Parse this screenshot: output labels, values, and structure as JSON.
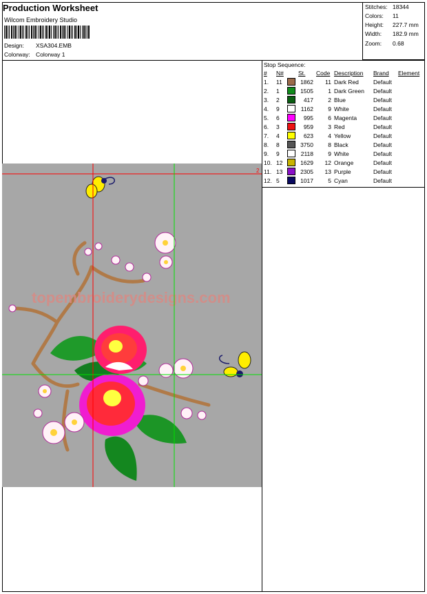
{
  "header": {
    "title": "Production Worksheet",
    "software": "Wilcom Embroidery Studio",
    "design_label": "Design:",
    "design_value": "XSA304.EMB",
    "colorway_label": "Colorway:",
    "colorway_value": "Colorway 1"
  },
  "stats": [
    {
      "label": "Stitches:",
      "value": "18344"
    },
    {
      "label": "Colors:",
      "value": "11"
    },
    {
      "label": "Height:",
      "value": "227.7 mm"
    },
    {
      "label": "Width:",
      "value": "182.9 mm"
    },
    {
      "label": "Zoom:",
      "value": "0.68"
    }
  ],
  "stop_sequence": {
    "title": "Stop Sequence:",
    "columns": [
      "#",
      "N#",
      "St.",
      "Code",
      "Description",
      "Brand",
      "Element"
    ],
    "rows": [
      {
        "idx": "1.",
        "n": "11",
        "st": "1862",
        "code": "11",
        "desc": "Dark Red",
        "brand": "Default",
        "color": "#9b6b4b"
      },
      {
        "idx": "2.",
        "n": "1",
        "st": "1505",
        "code": "1",
        "desc": "Dark Green",
        "brand": "Default",
        "color": "#108c1c"
      },
      {
        "idx": "3.",
        "n": "2",
        "st": "417",
        "code": "2",
        "desc": "Blue",
        "brand": "Default",
        "color": "#0b5e12"
      },
      {
        "idx": "4.",
        "n": "9",
        "st": "1162",
        "code": "9",
        "desc": "White",
        "brand": "Default",
        "color": "#ffffff"
      },
      {
        "idx": "5.",
        "n": "6",
        "st": "995",
        "code": "6",
        "desc": "Magenta",
        "brand": "Default",
        "color": "#ff00ff"
      },
      {
        "idx": "6.",
        "n": "3",
        "st": "959",
        "code": "3",
        "desc": "Red",
        "brand": "Default",
        "color": "#ee1111"
      },
      {
        "idx": "7.",
        "n": "4",
        "st": "623",
        "code": "4",
        "desc": "Yellow",
        "brand": "Default",
        "color": "#ffff00"
      },
      {
        "idx": "8.",
        "n": "8",
        "st": "3750",
        "code": "8",
        "desc": "Black",
        "brand": "Default",
        "color": "#555555"
      },
      {
        "idx": "9.",
        "n": "9",
        "st": "2118",
        "code": "9",
        "desc": "White",
        "brand": "Default",
        "color": "#ffffff"
      },
      {
        "idx": "10.",
        "n": "12",
        "st": "1629",
        "code": "12",
        "desc": "Orange",
        "brand": "Default",
        "color": "#c8b400"
      },
      {
        "idx": "11.",
        "n": "13",
        "st": "2305",
        "code": "13",
        "desc": "Purple",
        "brand": "Default",
        "color": "#8a10c8"
      },
      {
        "idx": "12.",
        "n": "5",
        "st": "1017",
        "code": "5",
        "desc": "Cyan",
        "brand": "Default",
        "color": "#0a0a60"
      }
    ]
  },
  "preview": {
    "watermark": "topembroiderydesigns.com",
    "marker": "2",
    "background_color": "#a7a7a7",
    "guide_red": "#ff0000",
    "guide_green": "#00e000"
  }
}
